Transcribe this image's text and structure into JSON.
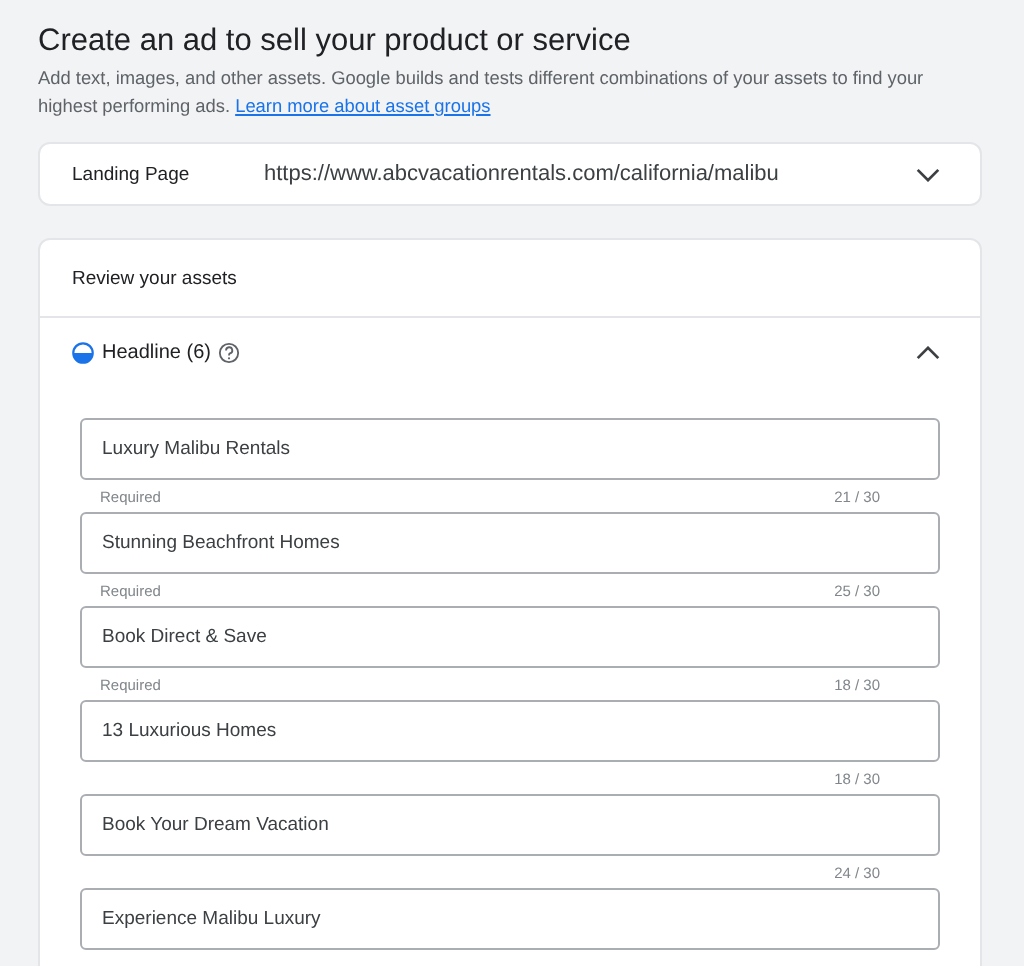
{
  "page": {
    "title": "Create an ad to sell your product or service",
    "description": "Add text, images, and other assets. Google builds and tests different combinations of your assets to find your highest performing ads.",
    "link": "Learn more about asset groups"
  },
  "landing_page": {
    "label": "Landing Page",
    "value": "https://www.abcvacationrentals.com/california/malibu",
    "expanded": false
  },
  "review": {
    "title": "Review your assets",
    "section": {
      "label": "Headline (6)",
      "expanded": true,
      "fields": [
        {
          "value": "Luxury Malibu Rentals",
          "helper": "Required",
          "counter": "21 / 30"
        },
        {
          "value": "Stunning Beachfront Homes",
          "helper": "Required",
          "counter": "25 / 30"
        },
        {
          "value": "Book Direct & Save",
          "helper": "Required",
          "counter": "18 / 30"
        },
        {
          "value": "13 Luxurious Homes",
          "counter": "18 / 30"
        },
        {
          "value": "Book Your Dream Vacation",
          "counter": "24 / 30"
        },
        {
          "value": "Experience Malibu Luxury"
        }
      ]
    }
  }
}
